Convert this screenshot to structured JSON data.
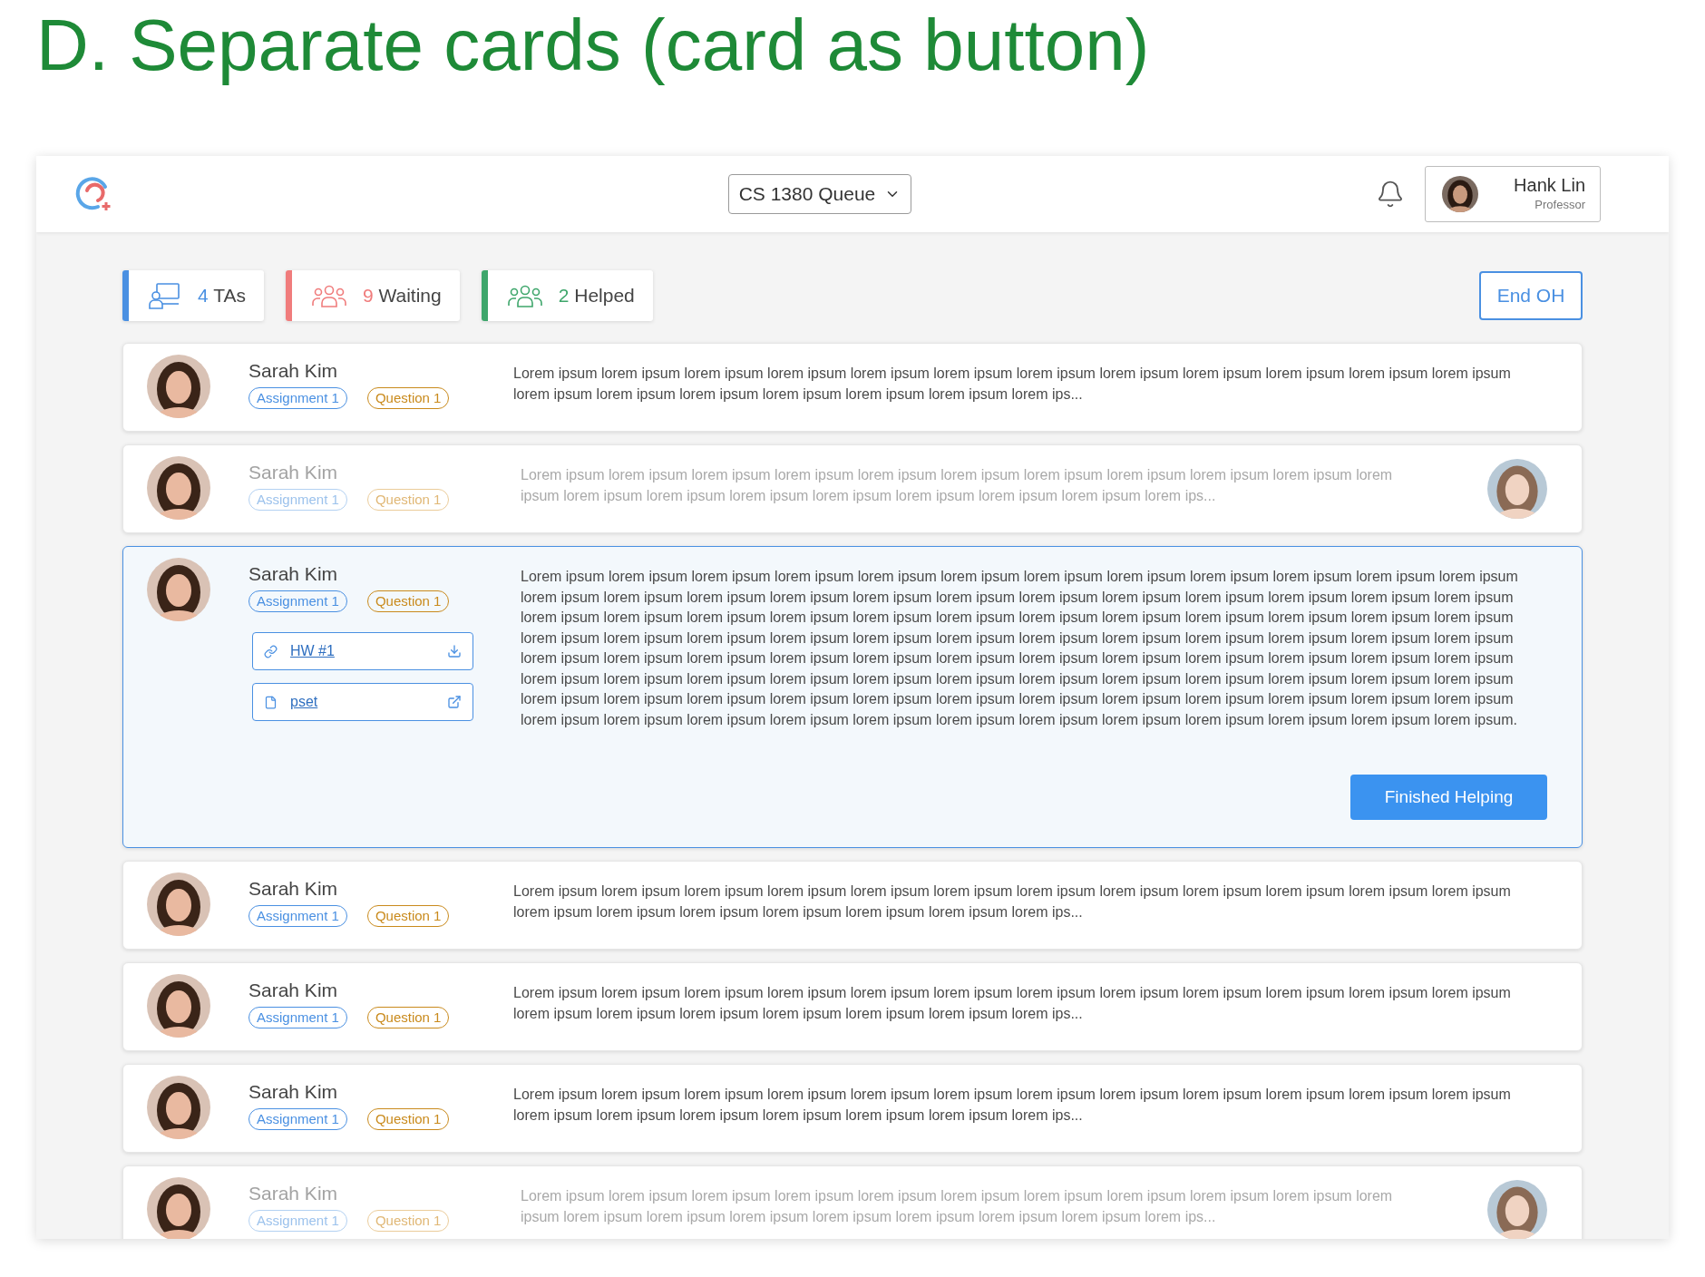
{
  "page_title": "D. Separate cards (card as button)",
  "header": {
    "queue": "CS 1380 Queue",
    "user": {
      "name": "Hank Lin",
      "role": "Professor"
    }
  },
  "stats": [
    {
      "kind": "tas",
      "count": "4",
      "label": "TAs",
      "color": "#4a90e2"
    },
    {
      "kind": "waiting",
      "count": "9",
      "label": "Waiting",
      "color": "#f07c7c"
    },
    {
      "kind": "helped",
      "count": "2",
      "label": "Helped",
      "color": "#3ea66b"
    }
  ],
  "end_button": "End OH",
  "cards": [
    {
      "kind": "waiting",
      "name": "Sarah Kim",
      "tags": [
        {
          "kind": "assignment",
          "label": "Assignment 1"
        },
        {
          "kind": "question",
          "label": "Question 1"
        }
      ],
      "text": "Lorem ipsum lorem ipsum lorem ipsum lorem ipsum lorem ipsum lorem ipsum lorem ipsum lorem ipsum lorem ipsum lorem ipsum lorem ipsum lorem ipsum lorem ipsum lorem ipsum lorem ipsum lorem ipsum lorem ipsum lorem ipsum lorem ips..."
    },
    {
      "kind": "helping",
      "name": "Sarah Kim",
      "tags": [
        {
          "kind": "assignment",
          "label": "Assignment 1"
        },
        {
          "kind": "question",
          "label": "Question 1"
        }
      ],
      "text": "Lorem ipsum lorem ipsum lorem ipsum lorem ipsum lorem ipsum lorem ipsum lorem ipsum lorem ipsum lorem ipsum lorem ipsum lorem ipsum lorem ipsum lorem ipsum lorem ipsum lorem ipsum lorem ipsum lorem ipsum lorem ipsum lorem ips..."
    },
    {
      "kind": "expanded",
      "name": "Sarah Kim",
      "tags": [
        {
          "kind": "assignment",
          "label": "Assignment 1"
        },
        {
          "kind": "question",
          "label": "Question 1"
        }
      ],
      "text": "Lorem ipsum lorem ipsum lorem ipsum lorem ipsum lorem ipsum lorem ipsum lorem ipsum lorem ipsum lorem ipsum lorem ipsum lorem ipsum lorem ipsum lorem ipsum lorem ipsum lorem ipsum lorem ipsum lorem ipsum lorem ipsum lorem ipsum lorem ipsum lorem ipsum lorem ipsum lorem ipsum lorem ipsum lorem ipsum lorem ipsum lorem ipsum lorem ipsum lorem ipsum lorem ipsum lorem ipsum lorem ipsum lorem ipsum lorem ipsum lorem ipsum lorem ipsum lorem ipsum lorem ipsum lorem ipsum lorem ipsum lorem ipsum lorem ipsum lorem ipsum lorem ipsum lorem ipsum lorem ipsum lorem ipsum lorem ipsum lorem ipsum lorem ipsum lorem ipsum lorem ipsum lorem ipsum lorem ipsum lorem ipsum lorem ipsum lorem ipsum lorem ipsum lorem ipsum lorem ipsum lorem ipsum lorem ipsum lorem ipsum lorem ipsum lorem ipsum lorem ipsum lorem ipsum lorem ipsum lorem ipsum lorem ipsum lorem ipsum lorem ipsum lorem ipsum lorem ipsum lorem ipsum lorem ipsum lorem ipsum lorem ipsum lorem ipsum lorem ipsum lorem ipsum lorem ipsum lorem ipsum lorem ipsum lorem ipsum lorem ipsum lorem ipsum lorem ipsum lorem ipsum lorem ipsum lorem ipsum lorem ipsum lorem ipsum lorem ipsum lorem ipsum lorem ipsum.",
      "attachments": [
        {
          "kind": "link",
          "label": "HW #1"
        },
        {
          "kind": "file",
          "label": "pset"
        }
      ],
      "action": "Finished Helping"
    },
    {
      "kind": "waiting",
      "name": "Sarah Kim",
      "tags": [
        {
          "kind": "assignment",
          "label": "Assignment 1"
        },
        {
          "kind": "question",
          "label": "Question 1"
        }
      ],
      "text": "Lorem ipsum lorem ipsum lorem ipsum lorem ipsum lorem ipsum lorem ipsum lorem ipsum lorem ipsum lorem ipsum lorem ipsum lorem ipsum lorem ipsum lorem ipsum lorem ipsum lorem ipsum lorem ipsum lorem ipsum lorem ipsum lorem ips..."
    },
    {
      "kind": "waiting",
      "name": "Sarah Kim",
      "tags": [
        {
          "kind": "assignment",
          "label": "Assignment 1"
        },
        {
          "kind": "question",
          "label": "Question 1"
        }
      ],
      "text": "Lorem ipsum lorem ipsum lorem ipsum lorem ipsum lorem ipsum lorem ipsum lorem ipsum lorem ipsum lorem ipsum lorem ipsum lorem ipsum lorem ipsum lorem ipsum lorem ipsum lorem ipsum lorem ipsum lorem ipsum lorem ipsum lorem ips..."
    },
    {
      "kind": "waiting",
      "name": "Sarah Kim",
      "tags": [
        {
          "kind": "assignment",
          "label": "Assignment 1"
        },
        {
          "kind": "question",
          "label": "Question 1"
        }
      ],
      "text": "Lorem ipsum lorem ipsum lorem ipsum lorem ipsum lorem ipsum lorem ipsum lorem ipsum lorem ipsum lorem ipsum lorem ipsum lorem ipsum lorem ipsum lorem ipsum lorem ipsum lorem ipsum lorem ipsum lorem ipsum lorem ipsum lorem ips..."
    },
    {
      "kind": "helping",
      "name": "Sarah Kim",
      "tags": [
        {
          "kind": "assignment",
          "label": "Assignment 1"
        },
        {
          "kind": "question",
          "label": "Question 1"
        }
      ],
      "text": "Lorem ipsum lorem ipsum lorem ipsum lorem ipsum lorem ipsum lorem ipsum lorem ipsum lorem ipsum lorem ipsum lorem ipsum lorem ipsum lorem ipsum lorem ipsum lorem ipsum lorem ipsum lorem ipsum lorem ipsum lorem ipsum lorem ips..."
    }
  ]
}
